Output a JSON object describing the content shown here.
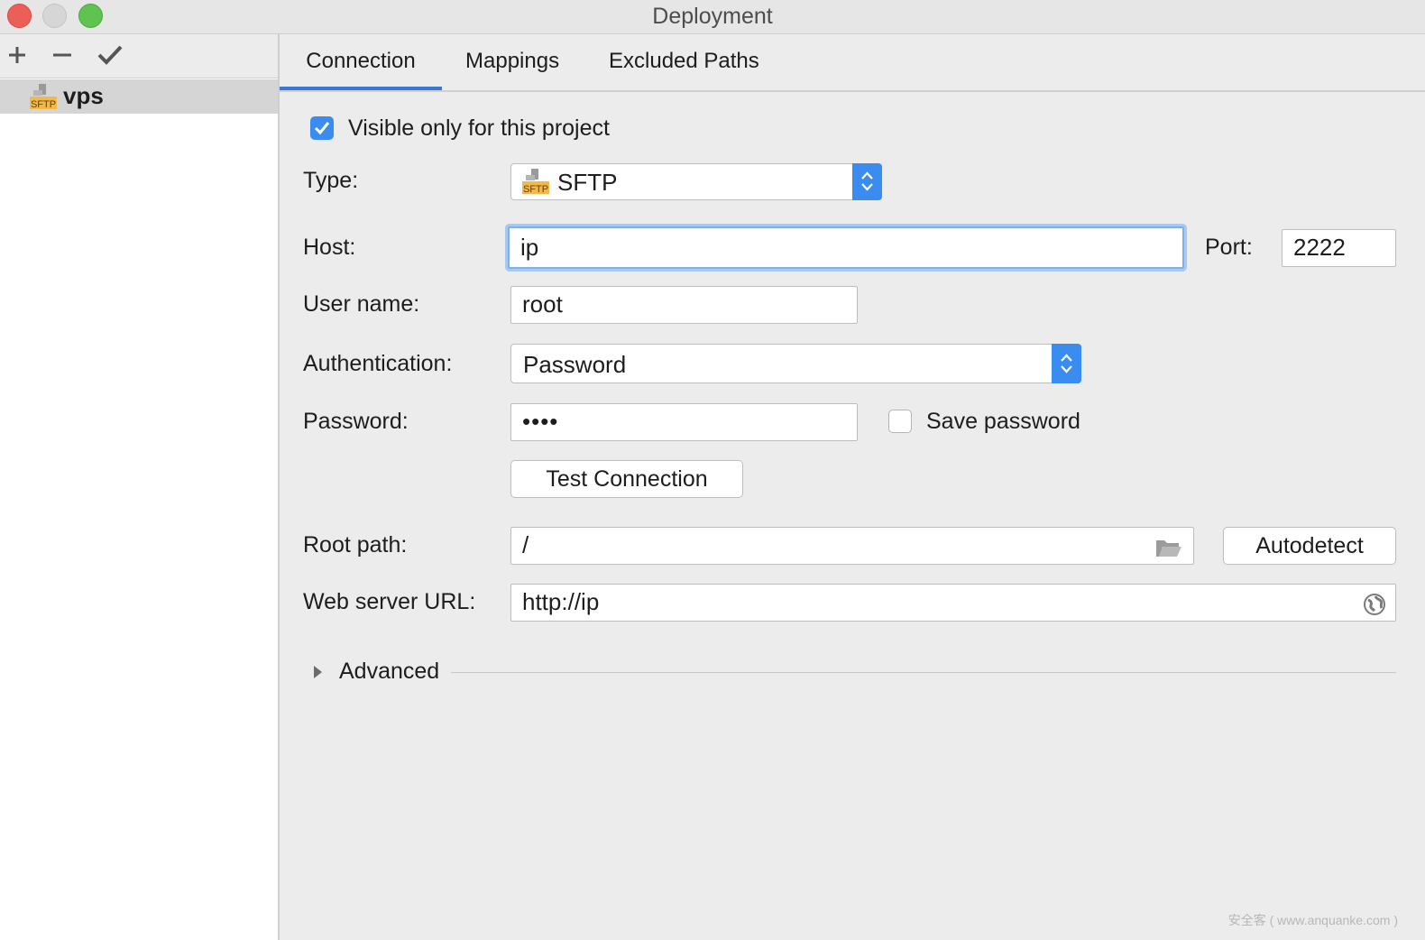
{
  "window": {
    "title": "Deployment"
  },
  "sidebar": {
    "toolbar": {
      "add_icon": "plus-icon",
      "remove_icon": "minus-icon",
      "apply_icon": "check-icon"
    },
    "servers": [
      {
        "name": "vps",
        "icon": "sftp-server-icon",
        "icon_text": "SFTP"
      }
    ]
  },
  "tabs": [
    {
      "label": "Connection",
      "active": true
    },
    {
      "label": "Mappings",
      "active": false
    },
    {
      "label": "Excluded Paths",
      "active": false
    }
  ],
  "connection": {
    "visible_only": {
      "label": "Visible only for this project",
      "checked": true
    },
    "type": {
      "label": "Type:",
      "value": "SFTP",
      "icon_text": "SFTP"
    },
    "host": {
      "label": "Host:",
      "value": "ip"
    },
    "port": {
      "label": "Port:",
      "value": "2222"
    },
    "username": {
      "label": "User name:",
      "value": "root"
    },
    "authentication": {
      "label": "Authentication:",
      "value": "Password"
    },
    "password": {
      "label": "Password:",
      "value": "••••"
    },
    "save_password": {
      "label": "Save password",
      "checked": false
    },
    "test_connection": {
      "label": "Test Connection"
    },
    "root_path": {
      "label": "Root path:",
      "value": "/"
    },
    "autodetect": {
      "label": "Autodetect"
    },
    "web_server_url": {
      "label": "Web server URL:",
      "value": "http://ip"
    },
    "advanced": {
      "label": "Advanced",
      "expanded": false
    }
  },
  "watermark": "安全客 ( www.anquanke.com )",
  "colors": {
    "accent": "#3b8cf0",
    "tab_underline": "#3b78d6",
    "focus_ring": "#a9c9f1"
  }
}
